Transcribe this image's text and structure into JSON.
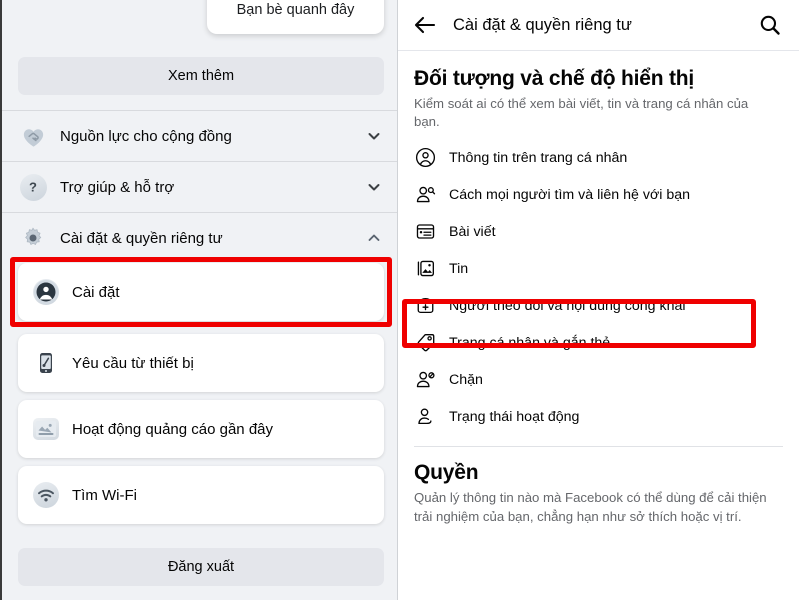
{
  "left_panel": {
    "floating_card": {
      "label": "Bạn bè quanh đây",
      "icon": "nearby-friends-card"
    },
    "see_more_button": {
      "label": "Xem thêm"
    },
    "collapsible_sections": [
      {
        "label": "Nguồn lực cho cộng đồng",
        "icon": "community-heart-icon",
        "chevron": "chevron-down-icon",
        "expanded": false
      },
      {
        "label": "Trợ giúp & hỗ trợ",
        "icon": "question-mark-icon",
        "chevron": "chevron-down-icon",
        "expanded": false
      },
      {
        "label": "Cài đặt & quyền riêng tư",
        "icon": "gear-icon",
        "chevron": "chevron-up-icon",
        "expanded": true
      }
    ],
    "items": [
      {
        "label": "Cài đặt",
        "icon": "account-circle-icon",
        "highlighted": true
      },
      {
        "label": "Yêu cầu từ thiết bị",
        "icon": "mobile-device-icon",
        "highlighted": false
      },
      {
        "label": "Hoạt động quảng cáo gần đây",
        "icon": "ad-activity-icon",
        "highlighted": false
      },
      {
        "label": "Tìm Wi-Fi",
        "icon": "wifi-icon",
        "highlighted": false
      }
    ],
    "logout_button": {
      "label": "Đăng xuất"
    }
  },
  "right_panel": {
    "header": {
      "back_icon": "back-arrow-icon",
      "title": "Cài đặt & quyền riêng tư",
      "search_icon": "search-icon"
    },
    "section_audience": {
      "title": "Đối tượng và chế độ hiển thị",
      "description": "Kiểm soát ai có thể xem bài viết, tin và trang cá nhân của bạn.",
      "items": [
        {
          "label": "Thông tin trên trang cá nhân",
          "icon": "person-circle-icon",
          "highlighted": false
        },
        {
          "label": "Cách mọi người tìm và liên hệ với bạn",
          "icon": "person-search-icon",
          "highlighted": false
        },
        {
          "label": "Bài viết",
          "icon": "post-card-icon",
          "highlighted": false
        },
        {
          "label": "Tin",
          "icon": "stories-photo-icon",
          "highlighted": false
        },
        {
          "label": "Người theo dõi và nội dung công khai",
          "icon": "follower-add-icon",
          "highlighted": true
        },
        {
          "label": "Trang cá nhân và gắn thẻ",
          "icon": "tag-icon",
          "highlighted": false
        },
        {
          "label": "Chặn",
          "icon": "block-person-icon",
          "highlighted": false
        },
        {
          "label": "Trạng thái hoạt động",
          "icon": "active-status-icon",
          "highlighted": false
        }
      ]
    },
    "section_permissions": {
      "title": "Quyền",
      "description": "Quản lý thông tin nào mà Facebook có thể dùng để cải thiện trải nghiệm của bạn, chẳng hạn như sở thích hoặc vị trí."
    }
  },
  "annotations": {
    "highlight_color": "#ef0000",
    "boxes": [
      {
        "name": "highlight-cai-dat",
        "target": "Cài đặt"
      },
      {
        "name": "highlight-nguoi-theo-doi",
        "target": "Người theo dõi và nội dung công khai"
      }
    ]
  }
}
